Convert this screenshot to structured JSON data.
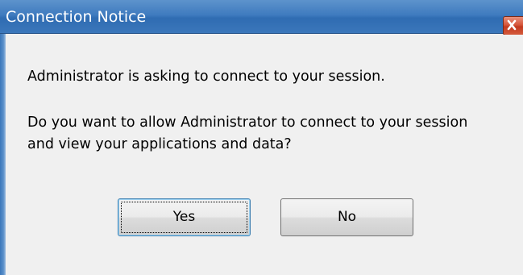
{
  "window": {
    "title": "Connection Notice"
  },
  "message": {
    "line1": "Administrator is asking to connect to your session.",
    "line2": "Do you want to allow Administrator to connect to your session and view your applications and data?"
  },
  "buttons": {
    "yes_label": "Yes",
    "no_label": "No"
  },
  "icons": {
    "close": "close-icon"
  },
  "colors": {
    "titlebar": "#3f7bbf",
    "close_button": "#d6553a",
    "body_background": "#f0f0f0"
  }
}
